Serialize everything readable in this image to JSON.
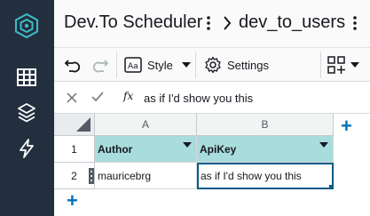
{
  "app": {
    "title": "Dev.To Scheduler",
    "table_name": "dev_to_users"
  },
  "rail": {
    "items": [
      {
        "icon": "logo-icon"
      },
      {
        "icon": "table-grid-icon"
      },
      {
        "icon": "layers-icon"
      },
      {
        "icon": "lightning-icon"
      }
    ]
  },
  "toolbar": {
    "undo_icon": "undo-icon",
    "redo_icon": "redo-icon",
    "style_label": "Style",
    "settings_label": "Settings",
    "add_column_icon": "add-widget-icon"
  },
  "formula_bar": {
    "fx_label": "fx",
    "value": "as if I'd show you this"
  },
  "grid": {
    "columns": [
      "A",
      "B"
    ],
    "rows": [
      "1",
      "2"
    ],
    "header_row": [
      "Author",
      "ApiKey"
    ],
    "data_rows": [
      [
        "mauricebrg",
        "as if I'd show you this"
      ]
    ]
  },
  "colors": {
    "rail_bg": "#232f3e",
    "header_cell_bg": "#a9dcdc",
    "accent_blue": "#0073bb",
    "selected_border": "#0a5a8a"
  }
}
